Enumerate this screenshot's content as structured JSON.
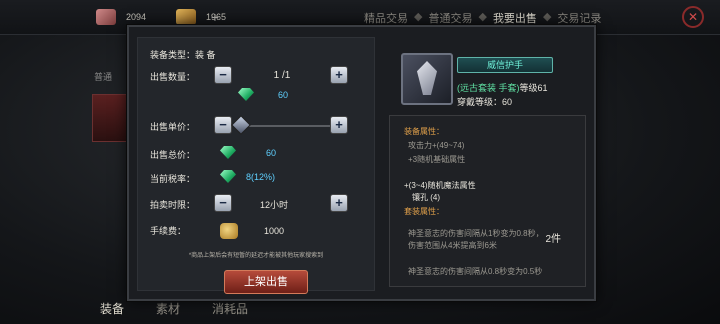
{
  "currencies": [
    {
      "value": "2094"
    },
    {
      "value": "1965"
    }
  ],
  "top_tabs": [
    "精品交易",
    "普通交易",
    "我要出售",
    "交易记录"
  ],
  "sidebar": {
    "label": "普通"
  },
  "bottom_tabs": [
    "装备",
    "素材",
    "消耗品"
  ],
  "sell": {
    "type_label": "装备类型：",
    "type_value": "装 备",
    "qty_label": "出售数量：",
    "qty_value": "1 /1",
    "unit_price_gems": "60",
    "unit_label": "出售单价：",
    "total_label": "出售总价：",
    "total_value": "60",
    "tax_label": "当前税率：",
    "tax_value": "8(12%)",
    "time_label": "拍卖时限：",
    "time_value": "12小时",
    "fee_label": "手续费：",
    "fee_value": "1000",
    "note": "*商品上架后会有短暂的延迟才能被其他玩家搜索到",
    "button": "上架出售"
  },
  "item": {
    "name": "威信护手",
    "set_text": "(远古套装 手套)",
    "level_text": "等级61",
    "req_text": "穿戴等级：60",
    "attr_header": "装备属性：",
    "attack": "攻击力+(49~74)",
    "random_base": "+3随机基础属性",
    "random_magic": "+(3~4)随机魔法属性",
    "sockets": "镶孔 (4)",
    "set_header": "套装属性：",
    "set_bonus_1": "神圣意志的伤害间隔从1秒变为0.8秒，",
    "set_bonus_2": "伤害范围从4米提高到6米",
    "set_count": "2件",
    "set_bonus_3": "神圣意志的伤害间隔从0.8秒变为0.5秒"
  }
}
